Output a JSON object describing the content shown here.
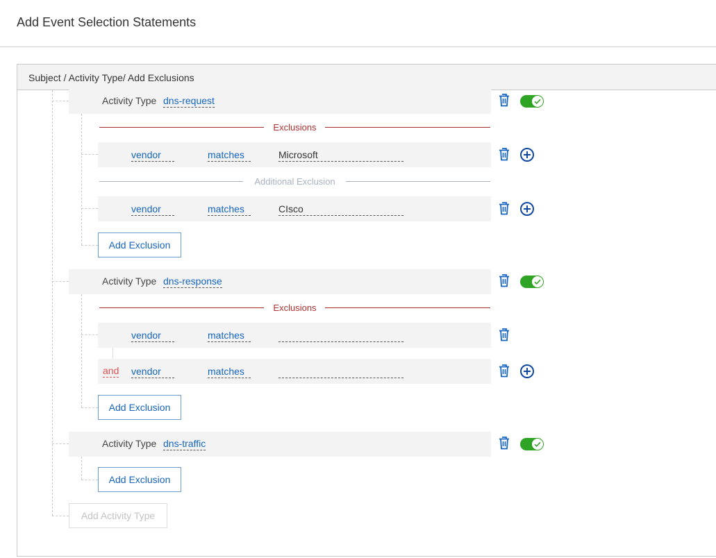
{
  "header": {
    "title": "Add Event Selection Statements"
  },
  "panel": {
    "breadcrumb": "Subject / Activity Type/ Add Exclusions"
  },
  "colors": {
    "accent": "#1565c0",
    "toggle_on": "#2fa324",
    "exclusion_red": "#a52a2a",
    "and_red": "#e05252",
    "muted": "#a9b3c1"
  },
  "activities": [
    {
      "label": "Activity Type",
      "value": "dns-request",
      "enabled": true,
      "exclusions_label": "Exclusions",
      "additional_label": "Additional Exclusion",
      "exclusions": [
        {
          "attribute": "vendor",
          "operator": "matches",
          "value": "Microsoft"
        },
        {
          "attribute": "vendor",
          "operator": "matches",
          "value": "CIsco"
        }
      ],
      "add_exclusion_label": "Add Exclusion"
    },
    {
      "label": "Activity Type",
      "value": "dns-response",
      "enabled": true,
      "exclusions_label": "Exclusions",
      "exclusions": [
        {
          "attribute": "vendor",
          "operator": "matches",
          "value": ""
        },
        {
          "conjunction": "and",
          "attribute": "vendor",
          "operator": "matches",
          "value": ""
        }
      ],
      "add_exclusion_label": "Add Exclusion"
    },
    {
      "label": "Activity Type",
      "value": "dns-traffic",
      "enabled": true,
      "add_exclusion_label": "Add Exclusion"
    }
  ],
  "add_activity_label": "Add Activity Type",
  "icons": {
    "delete": "trash-icon",
    "add": "plus-circle-icon",
    "toggle": "check-toggle-icon"
  }
}
